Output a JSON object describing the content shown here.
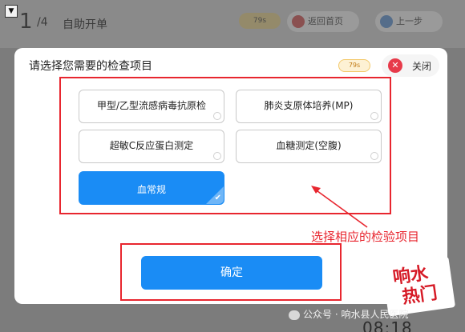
{
  "background": {
    "menu_toggle": "▼",
    "step_number": "1",
    "step_total": "/4",
    "page_title": "自助开单",
    "timer_text": "79s",
    "home_button": "返回首页",
    "prev_button": "上一步",
    "clock": "08:18"
  },
  "modal": {
    "title": "请选择您需要的检查项目",
    "timer_text": "79s",
    "close_label": "关闭",
    "options": [
      {
        "label": "甲型/乙型流感病毒抗原检",
        "selected": false
      },
      {
        "label": "肺炎支原体培养(MP)",
        "selected": false
      },
      {
        "label": "超敏C反应蛋白测定",
        "selected": false
      },
      {
        "label": "血糖测定(空腹)",
        "selected": false
      },
      {
        "label": "血常规",
        "selected": true
      }
    ],
    "confirm_label": "确定"
  },
  "annotation": {
    "text": "选择相应的检验项目",
    "color": "#e8262f"
  },
  "watermark": {
    "logo_line1": "响水",
    "logo_line2": "热门",
    "account": "公众号 · 响水县人民医院"
  },
  "colors": {
    "primary": "#1a8cf5",
    "annotation_red": "#e8262f",
    "close_red": "#e73a4a"
  }
}
